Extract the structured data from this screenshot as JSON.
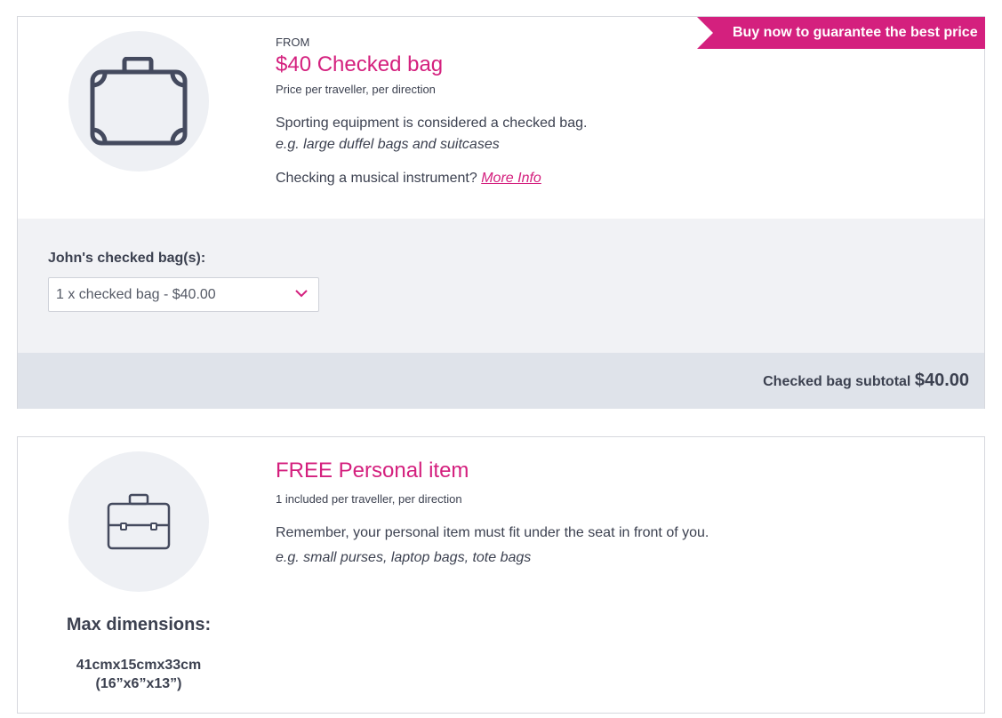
{
  "checked_bag": {
    "banner": "Buy now to guarantee the best price",
    "from_label": "FROM",
    "title": "$40 Checked bag",
    "price_note": "Price per traveller, per direction",
    "description": "Sporting equipment is considered a checked bag.",
    "examples": "e.g. large duffel bags and suitcases",
    "instrument_question": "Checking a musical instrument?",
    "more_info_link": "More Info",
    "select_label": "John's checked bag(s):",
    "select_value": "1 x checked bag - $40.00",
    "subtotal_label": "Checked bag subtotal",
    "subtotal_amount": "$40.00",
    "icon": "suitcase-icon"
  },
  "personal_item": {
    "title": "FREE Personal item",
    "note": "1 included per traveller, per direction",
    "description": "Remember, your personal item must fit under the seat in front of you.",
    "examples": "e.g. small purses, laptop bags, tote bags",
    "dims_label": "Max dimensions:",
    "dims_metric": "41cmx15cmx33cm",
    "dims_imperial": "(16”x6”x13”)",
    "icon": "briefcase-icon"
  },
  "colors": {
    "accent": "#d4207e",
    "text": "#3c4150",
    "panel": "#f1f2f5",
    "subtotal_bg": "#dfe3ea"
  }
}
